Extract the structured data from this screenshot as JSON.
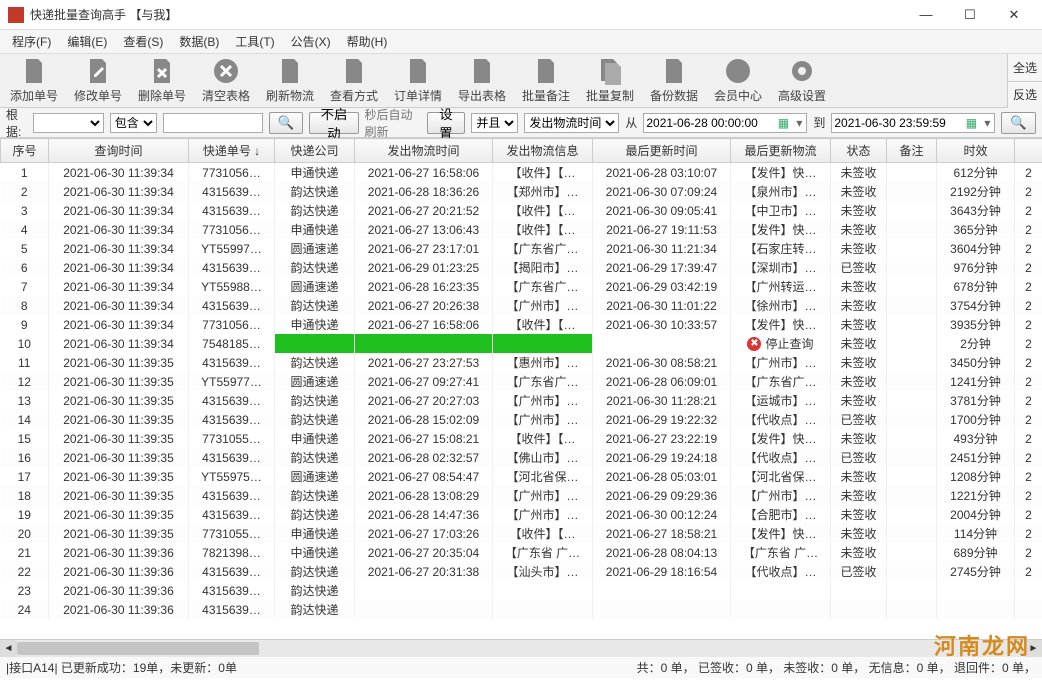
{
  "window": {
    "title": "快递批量查询高手 【与我】",
    "min": "—",
    "max": "☐",
    "close": "✕"
  },
  "menu": [
    "程序(F)",
    "编辑(E)",
    "查看(S)",
    "数据(B)",
    "工具(T)",
    "公告(X)",
    "帮助(H)"
  ],
  "toolbar": [
    {
      "id": "add",
      "label": "添加单号"
    },
    {
      "id": "edit",
      "label": "修改单号"
    },
    {
      "id": "del",
      "label": "删除单号"
    },
    {
      "id": "clear",
      "label": "清空表格"
    },
    {
      "id": "refresh",
      "label": "刷新物流"
    },
    {
      "id": "viewmode",
      "label": "查看方式"
    },
    {
      "id": "detail",
      "label": "订单详情"
    },
    {
      "id": "export",
      "label": "导出表格"
    },
    {
      "id": "batchremark",
      "label": "批量备注"
    },
    {
      "id": "batchcopy",
      "label": "批量复制"
    },
    {
      "id": "backup",
      "label": "备份数据"
    },
    {
      "id": "member",
      "label": "会员中心"
    },
    {
      "id": "advanced",
      "label": "高级设置"
    }
  ],
  "sidebtns": {
    "selectall": "全选",
    "invert": "反选"
  },
  "filter": {
    "root_label": "根据:",
    "root_value": "",
    "contain_value": "包含",
    "search_value": "",
    "nostart_label": "不启动",
    "autorefresh_label": "秒后自动刷新",
    "settings_label": "设置",
    "and_value": "并且",
    "time_field_value": "发出物流时间",
    "from_label": "从",
    "date_from": "2021-06-28 00:00:00",
    "to_label": "到",
    "date_to": "2021-06-30 23:59:59"
  },
  "columns": [
    "序号",
    "查询时间",
    "快递单号 ↓",
    "快递公司",
    "发出物流时间",
    "发出物流信息",
    "最后更新时间",
    "最后更新物流",
    "状态",
    "备注",
    "时效",
    ""
  ],
  "rows": [
    {
      "n": "1",
      "qt": "2021-06-30 11:39:34",
      "no": "7731056…",
      "co": "申通快递",
      "st": "2021-06-27 16:58:06",
      "si": "【收件】【…",
      "lt": "2021-06-28 03:10:07",
      "li": "【发件】快…",
      "stts": "未签收",
      "remark": "",
      "dur": "612分钟",
      "ex": "2"
    },
    {
      "n": "2",
      "qt": "2021-06-30 11:39:34",
      "no": "4315639…",
      "co": "韵达快递",
      "st": "2021-06-28 18:36:26",
      "si": "【郑州市】…",
      "lt": "2021-06-30 07:09:24",
      "li": "【泉州市】…",
      "stts": "未签收",
      "remark": "",
      "dur": "2192分钟",
      "ex": "2"
    },
    {
      "n": "3",
      "qt": "2021-06-30 11:39:34",
      "no": "4315639…",
      "co": "韵达快递",
      "st": "2021-06-27 20:21:52",
      "si": "【收件】【…",
      "lt": "2021-06-30 09:05:41",
      "li": "【中卫市】…",
      "stts": "未签收",
      "remark": "",
      "dur": "3643分钟",
      "ex": "2"
    },
    {
      "n": "4",
      "qt": "2021-06-30 11:39:34",
      "no": "7731056…",
      "co": "申通快递",
      "st": "2021-06-27 13:06:43",
      "si": "【收件】【…",
      "lt": "2021-06-27 19:11:53",
      "li": "【发件】快…",
      "stts": "未签收",
      "remark": "",
      "dur": "365分钟",
      "ex": "2"
    },
    {
      "n": "5",
      "qt": "2021-06-30 11:39:34",
      "no": "YT55997…",
      "co": "圆通速递",
      "st": "2021-06-27 23:17:01",
      "si": "【广东省广…",
      "lt": "2021-06-30 11:21:34",
      "li": "【石家庄转…",
      "stts": "未签收",
      "remark": "",
      "dur": "3604分钟",
      "ex": "2"
    },
    {
      "n": "6",
      "qt": "2021-06-30 11:39:34",
      "no": "4315639…",
      "co": "韵达快递",
      "st": "2021-06-29 01:23:25",
      "si": "【揭阳市】…",
      "lt": "2021-06-29 17:39:47",
      "li": "【深圳市】…",
      "stts": "已签收",
      "remark": "",
      "dur": "976分钟",
      "ex": "2"
    },
    {
      "n": "7",
      "qt": "2021-06-30 11:39:34",
      "no": "YT55988…",
      "co": "圆通速递",
      "st": "2021-06-28 16:23:35",
      "si": "【广东省广…",
      "lt": "2021-06-29 03:42:19",
      "li": "【广州转运…",
      "stts": "未签收",
      "remark": "",
      "dur": "678分钟",
      "ex": "2"
    },
    {
      "n": "8",
      "qt": "2021-06-30 11:39:34",
      "no": "4315639…",
      "co": "韵达快递",
      "st": "2021-06-27 20:26:38",
      "si": "【广州市】…",
      "lt": "2021-06-30 11:01:22",
      "li": "【徐州市】…",
      "stts": "未签收",
      "remark": "",
      "dur": "3754分钟",
      "ex": "2"
    },
    {
      "n": "9",
      "qt": "2021-06-30 11:39:34",
      "no": "7731056…",
      "co": "申通快递",
      "st": "2021-06-27 16:58:06",
      "si": "【收件】【…",
      "lt": "2021-06-30 10:33:57",
      "li": "【发件】快…",
      "stts": "未签收",
      "remark": "",
      "dur": "3935分钟",
      "ex": "2"
    },
    {
      "n": "10",
      "qt": "2021-06-30 11:39:34",
      "no": "7548185…",
      "co": "",
      "st": "",
      "si": "",
      "lt": "",
      "li": "",
      "stts": "未签收",
      "remark": "",
      "dur": "2分钟",
      "ex": "2",
      "green": true,
      "stop": true
    },
    {
      "n": "11",
      "qt": "2021-06-30 11:39:35",
      "no": "4315639…",
      "co": "韵达快递",
      "st": "2021-06-27 23:27:53",
      "si": "【惠州市】…",
      "lt": "2021-06-30 08:58:21",
      "li": "【广州市】…",
      "stts": "未签收",
      "remark": "",
      "dur": "3450分钟",
      "ex": "2"
    },
    {
      "n": "12",
      "qt": "2021-06-30 11:39:35",
      "no": "YT55977…",
      "co": "圆通速递",
      "st": "2021-06-27 09:27:41",
      "si": "【广东省广…",
      "lt": "2021-06-28 06:09:01",
      "li": "【广东省广…",
      "stts": "未签收",
      "remark": "",
      "dur": "1241分钟",
      "ex": "2"
    },
    {
      "n": "13",
      "qt": "2021-06-30 11:39:35",
      "no": "4315639…",
      "co": "韵达快递",
      "st": "2021-06-27 20:27:03",
      "si": "【广州市】…",
      "lt": "2021-06-30 11:28:21",
      "li": "【运城市】…",
      "stts": "未签收",
      "remark": "",
      "dur": "3781分钟",
      "ex": "2"
    },
    {
      "n": "14",
      "qt": "2021-06-30 11:39:35",
      "no": "4315639…",
      "co": "韵达快递",
      "st": "2021-06-28 15:02:09",
      "si": "【广州市】…",
      "lt": "2021-06-29 19:22:32",
      "li": "【代收点】…",
      "stts": "已签收",
      "remark": "",
      "dur": "1700分钟",
      "ex": "2"
    },
    {
      "n": "15",
      "qt": "2021-06-30 11:39:35",
      "no": "7731055…",
      "co": "申通快递",
      "st": "2021-06-27 15:08:21",
      "si": "【收件】【…",
      "lt": "2021-06-27 23:22:19",
      "li": "【发件】快…",
      "stts": "未签收",
      "remark": "",
      "dur": "493分钟",
      "ex": "2"
    },
    {
      "n": "16",
      "qt": "2021-06-30 11:39:35",
      "no": "4315639…",
      "co": "韵达快递",
      "st": "2021-06-28 02:32:57",
      "si": "【佛山市】…",
      "lt": "2021-06-29 19:24:18",
      "li": "【代收点】…",
      "stts": "已签收",
      "remark": "",
      "dur": "2451分钟",
      "ex": "2"
    },
    {
      "n": "17",
      "qt": "2021-06-30 11:39:35",
      "no": "YT55975…",
      "co": "圆通速递",
      "st": "2021-06-27 08:54:47",
      "si": "【河北省保…",
      "lt": "2021-06-28 05:03:01",
      "li": "【河北省保…",
      "stts": "未签收",
      "remark": "",
      "dur": "1208分钟",
      "ex": "2"
    },
    {
      "n": "18",
      "qt": "2021-06-30 11:39:35",
      "no": "4315639…",
      "co": "韵达快递",
      "st": "2021-06-28 13:08:29",
      "si": "【广州市】…",
      "lt": "2021-06-29 09:29:36",
      "li": "【广州市】…",
      "stts": "未签收",
      "remark": "",
      "dur": "1221分钟",
      "ex": "2"
    },
    {
      "n": "19",
      "qt": "2021-06-30 11:39:35",
      "no": "4315639…",
      "co": "韵达快递",
      "st": "2021-06-28 14:47:36",
      "si": "【广州市】…",
      "lt": "2021-06-30 00:12:24",
      "li": "【合肥市】…",
      "stts": "未签收",
      "remark": "",
      "dur": "2004分钟",
      "ex": "2"
    },
    {
      "n": "20",
      "qt": "2021-06-30 11:39:35",
      "no": "7731055…",
      "co": "申通快递",
      "st": "2021-06-27 17:03:26",
      "si": "【收件】【…",
      "lt": "2021-06-27 18:58:21",
      "li": "【发件】快…",
      "stts": "未签收",
      "remark": "",
      "dur": "114分钟",
      "ex": "2"
    },
    {
      "n": "21",
      "qt": "2021-06-30 11:39:36",
      "no": "7821398…",
      "co": "中通快递",
      "st": "2021-06-27 20:35:04",
      "si": "【广东省 广…",
      "lt": "2021-06-28 08:04:13",
      "li": "【广东省 广…",
      "stts": "未签收",
      "remark": "",
      "dur": "689分钟",
      "ex": "2"
    },
    {
      "n": "22",
      "qt": "2021-06-30 11:39:36",
      "no": "4315639…",
      "co": "韵达快递",
      "st": "2021-06-27 20:31:38",
      "si": "【汕头市】…",
      "lt": "2021-06-29 18:16:54",
      "li": "【代收点】…",
      "stts": "已签收",
      "remark": "",
      "dur": "2745分钟",
      "ex": "2"
    },
    {
      "n": "23",
      "qt": "2021-06-30 11:39:36",
      "no": "4315639…",
      "co": "韵达快递",
      "st": "",
      "si": "",
      "lt": "",
      "li": "",
      "stts": "",
      "remark": "",
      "dur": "",
      "ex": ""
    },
    {
      "n": "24",
      "qt": "2021-06-30 11:39:36",
      "no": "4315639…",
      "co": "韵达快递",
      "st": "",
      "si": "",
      "lt": "",
      "li": "",
      "stts": "",
      "remark": "",
      "dur": "",
      "ex": ""
    }
  ],
  "stop_query_label": "停止查询",
  "status": {
    "left": "|接口A14| 已更新成功：19单，未更新：0单",
    "right": "共：0 单，  已签收：0 单，  未签收：0 单，  无信息：0 单，  退回件：0 单，"
  },
  "watermark": "河南龙网"
}
